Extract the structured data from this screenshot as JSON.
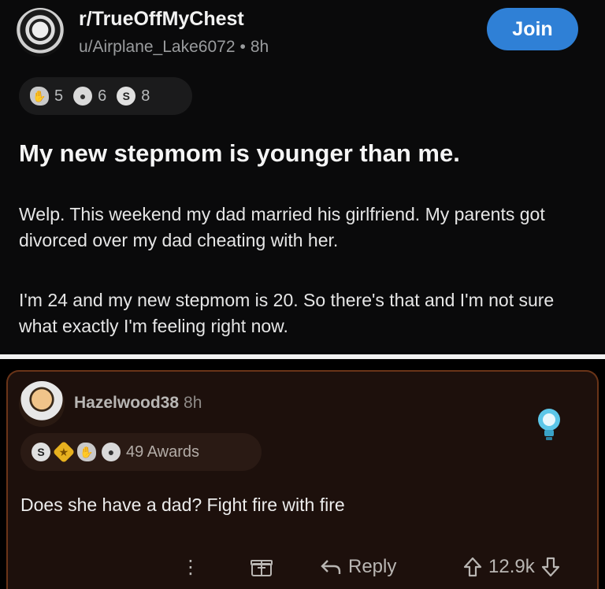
{
  "post": {
    "subreddit": "r/TrueOffMyChest",
    "author": "u/Airplane_Lake6072",
    "separator": "•",
    "age": "8h",
    "join_label": "Join",
    "awards": [
      {
        "icon": "hands-award-icon",
        "count": "5"
      },
      {
        "icon": "speech-bubble-award-icon",
        "count": "6"
      },
      {
        "icon": "silver-award-icon",
        "count": "8"
      }
    ],
    "title": "My new stepmom is younger than me.",
    "paragraphs": [
      "Welp. This weekend my dad married his girlfriend. My parents got divorced over my dad cheating with her.",
      "I'm 24 and my new stepmom is 20. So there's that and I'm not sure what exactly I'm feeling right now."
    ]
  },
  "comment": {
    "username": "Hazelwood38",
    "age": "8h",
    "awards_label": "49 Awards",
    "text": "Does she have a dad? Fight fire with fire",
    "actions": {
      "more": "⋮",
      "reply_label": "Reply",
      "score": "12.9k"
    }
  },
  "colors": {
    "join_button": "#2f80d6",
    "comment_background": "#1d100c",
    "comment_border": "#6a3418",
    "divider": "#f2f2f2"
  }
}
